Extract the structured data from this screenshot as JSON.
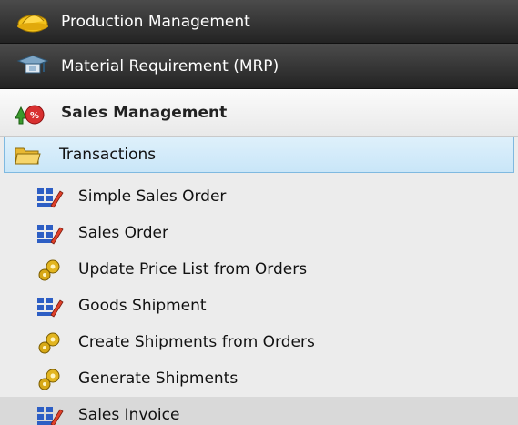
{
  "menu": {
    "headers": [
      {
        "label": "Production Management",
        "icon": "hardhat-icon"
      },
      {
        "label": "Material Requirement (MRP)",
        "icon": "graduation-cap-icon"
      }
    ],
    "section": {
      "label": "Sales Management",
      "icon": "sales-arrows-icon"
    },
    "folder": {
      "label": "Transactions",
      "icon": "folder-icon"
    },
    "items": [
      {
        "label": "Simple Sales Order",
        "icon": "form-edit-icon"
      },
      {
        "label": "Sales Order",
        "icon": "form-edit-icon"
      },
      {
        "label": "Update Price List from Orders",
        "icon": "gears-icon"
      },
      {
        "label": "Goods Shipment",
        "icon": "form-edit-icon"
      },
      {
        "label": "Create Shipments from Orders",
        "icon": "gears-icon"
      },
      {
        "label": "Generate Shipments",
        "icon": "gears-icon"
      },
      {
        "label": "Sales Invoice",
        "icon": "form-edit-icon"
      }
    ],
    "colors": {
      "header_bg": "#2f2f2f",
      "folder_bg": "#d3ebf9",
      "folder_border": "#7fb9e0",
      "selected_bg": "#d9d9d9"
    }
  }
}
